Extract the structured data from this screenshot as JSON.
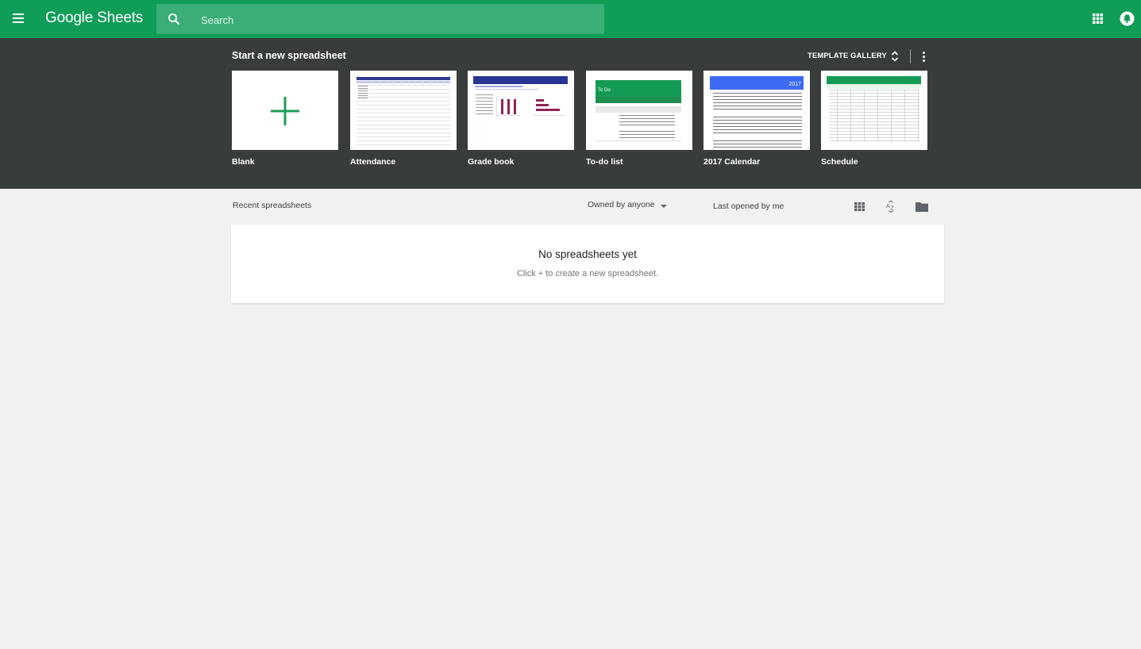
{
  "appbar": {
    "title": "Google Sheets",
    "search_placeholder": "Search",
    "color": "#0f9d58"
  },
  "templates": {
    "heading": "Start a new spreadsheet",
    "gallery_label": "TEMPLATE GALLERY",
    "items": [
      {
        "label": "Blank"
      },
      {
        "label": "Attendance"
      },
      {
        "label": "Grade book"
      },
      {
        "label": "To-do list",
        "thumb_title": "To Do"
      },
      {
        "label": "2017 Calendar",
        "thumb_year": "2017"
      },
      {
        "label": "Schedule"
      }
    ]
  },
  "recent": {
    "title": "Recent spreadsheets",
    "owner_filter": "Owned by anyone",
    "sort_label": "Last opened by me",
    "empty_title": "No spreadsheets yet",
    "empty_subtitle": "Click + to create a new spreadsheet."
  },
  "icons": [
    "menu-icon",
    "search-icon",
    "apps-grid-icon",
    "account-icon",
    "unfold-icon",
    "more-vert-icon",
    "grid-view-icon",
    "sort-az-icon",
    "folder-icon",
    "plus-icon"
  ]
}
